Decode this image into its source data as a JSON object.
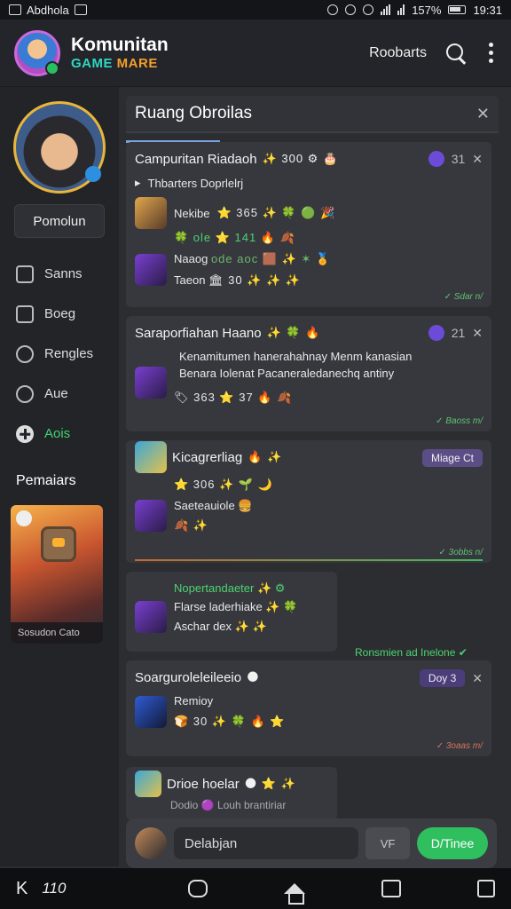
{
  "status": {
    "left_app": "Abdhola",
    "battery": "157%",
    "time": "19:31"
  },
  "header": {
    "title": "Komunitan",
    "sub_a": "GAME",
    "sub_b": "MARE",
    "link": "Roobarts"
  },
  "sidebar": {
    "button": "Pomolun",
    "items": [
      {
        "label": "Sanns",
        "icon": "image-icon"
      },
      {
        "label": "Boeg",
        "icon": "folder-icon"
      },
      {
        "label": "Rengles",
        "icon": "clock-icon"
      },
      {
        "label": "Aue",
        "icon": "chat-icon"
      },
      {
        "label": "Aois",
        "icon": "plus-icon"
      }
    ],
    "section": "Pemaiars",
    "banner_caption": "Sosudon Cato"
  },
  "room": {
    "title": "Ruang Obroilas"
  },
  "cards": [
    {
      "title": "Campuritan Riadaoh",
      "title_emoji": "✨ 300 ⚙ 🎂",
      "count": "31",
      "line1": "Thbarters Doprlelrj",
      "line2_text": "Nekibe",
      "line2_emoji": "⭐ 365 ✨ 🍀 🟢 🎉",
      "line3_emoji": "🍀 ole ⭐ 141 🔥 🍂",
      "line4_text": "Naaog",
      "line4_emoji": "ode aoc 🟫 ✨ ✶ 🏅",
      "line5_text": "Taeon",
      "line5_emoji": "🏛 30 ✨ ✨ ✨",
      "time": "✓ Sdar n/"
    },
    {
      "title": "Saraporfiahan Haano",
      "title_emoji": "✨ 🍀 🔥",
      "count": "21",
      "line1": "Kenamitumen hanerahahnay Menm kanasian",
      "line2": "Benara Iolenat Pacaneraledanechq antiny",
      "line3_emoji": "🏷 363 ⭐ 37 🔥 🍂",
      "time": "✓ Baoss m/"
    },
    {
      "title": "Kicagrerliag",
      "title_emoji": "🔥 ✨",
      "pill": "Miage Ct",
      "line1_emoji": "⭐ 306 ✨ 🌱 🌙",
      "line2": "Saeteauiole 🍔",
      "line3_emoji": "🍂 ✨",
      "time": "✓ 3obbs n/"
    },
    {
      "title": "Nopertandaeter ✨ ⚙",
      "line1": "Flarse laderhiake ✨ 🍀",
      "line2": "Aschar dex ✨ ✨",
      "right": "Ronsmien ad Inelone ✔"
    },
    {
      "title": "Soarguroleleileeio",
      "title_emoji": "🌑",
      "pill": "Doy 3",
      "line1": "Remioy",
      "line2_emoji": "🍞 30 ✨ 🍀 🔥 ⭐",
      "time": "✓ 3oaas m/"
    },
    {
      "title": "Drioe hoelar",
      "title_emoji": "🌑 ⭐ ✨",
      "line1": "Dodio 🟣 Louh brantiriar"
    }
  ],
  "composer": {
    "placeholder": "Delabjan",
    "attach": "VF",
    "send": "D/Tinee"
  },
  "navbar": {
    "k": "K",
    "t": "110"
  }
}
